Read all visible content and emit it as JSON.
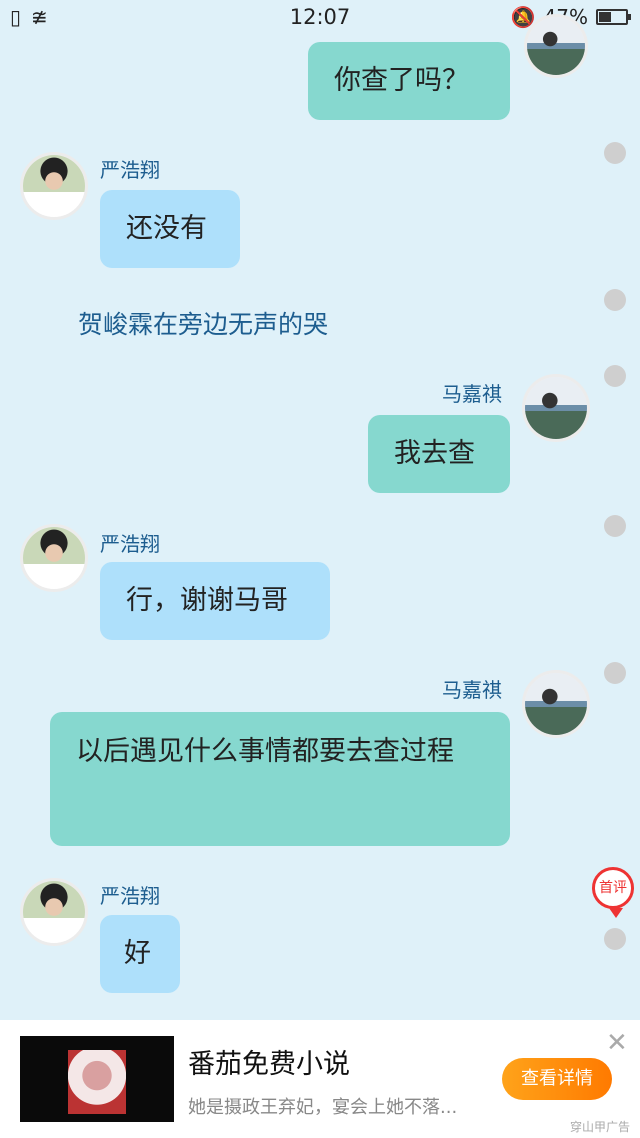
{
  "status_bar": {
    "time": "12:07",
    "battery": "47%",
    "battery_level": 0.47
  },
  "chat": {
    "messages": [
      {
        "sender": "",
        "text": "你查了吗？",
        "side": "right"
      },
      {
        "sender": "严浩翔",
        "text": "还没有",
        "side": "left"
      },
      {
        "narration": "贺峻霖在旁边无声的哭"
      },
      {
        "sender": "马嘉祺",
        "text": "我去查",
        "side": "right"
      },
      {
        "sender": "严浩翔",
        "text": "行，谢谢马哥",
        "side": "left"
      },
      {
        "sender": "马嘉祺",
        "text": "以后遇见什么事情都要去查过程",
        "side": "right"
      },
      {
        "sender": "严浩翔",
        "text": "好",
        "side": "left"
      }
    ],
    "first_comment_label": "首评"
  },
  "ad": {
    "title": "番茄免费小说",
    "description": "她是摄政王弃妃，宴会上她不落...",
    "button_label": "查看详情",
    "source": "穿山甲广告"
  }
}
